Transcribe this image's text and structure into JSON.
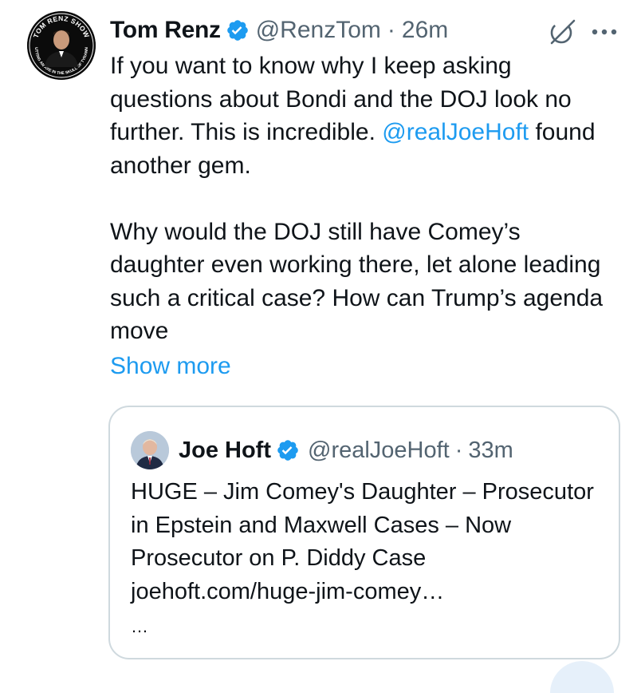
{
  "author": {
    "display_name": "Tom Renz",
    "handle": "@RenzTom",
    "separator": "·",
    "time": "26m",
    "avatar_text_top": "TOM RENZ SHOW",
    "avatar_text_bottom": "PUTTING AN AXE IN THE SKULL OF TYRANNY"
  },
  "icons": {
    "verified": "verified-badge-icon",
    "grok": "grok-icon",
    "more": "more-options-icon"
  },
  "tweet": {
    "para1_part1": "If you want to know why I keep asking questions about Bondi and the DOJ look no further. This is incredible. ",
    "mention": "@realJoeHoft",
    "para1_part2": " found another gem.",
    "para2": "Why would the DOJ still have Comey’s daughter even working there, let alone leading such a critical case? How can Trump’s agenda move",
    "show_more": "Show more"
  },
  "quote": {
    "display_name": "Joe Hoft",
    "handle": "@realJoeHoft",
    "separator": "·",
    "time": "33m",
    "text": "HUGE – Jim Comey's Daughter – Prosecutor in Epstein and Maxwell Cases – Now Prosecutor on P. Diddy Case",
    "link": "joehoft.com/huge-jim-comey…",
    "ellipsis": "…"
  },
  "colors": {
    "text": "#0f1419",
    "secondary": "#536471",
    "accent": "#1d9bf0",
    "border": "#cfd9de"
  }
}
